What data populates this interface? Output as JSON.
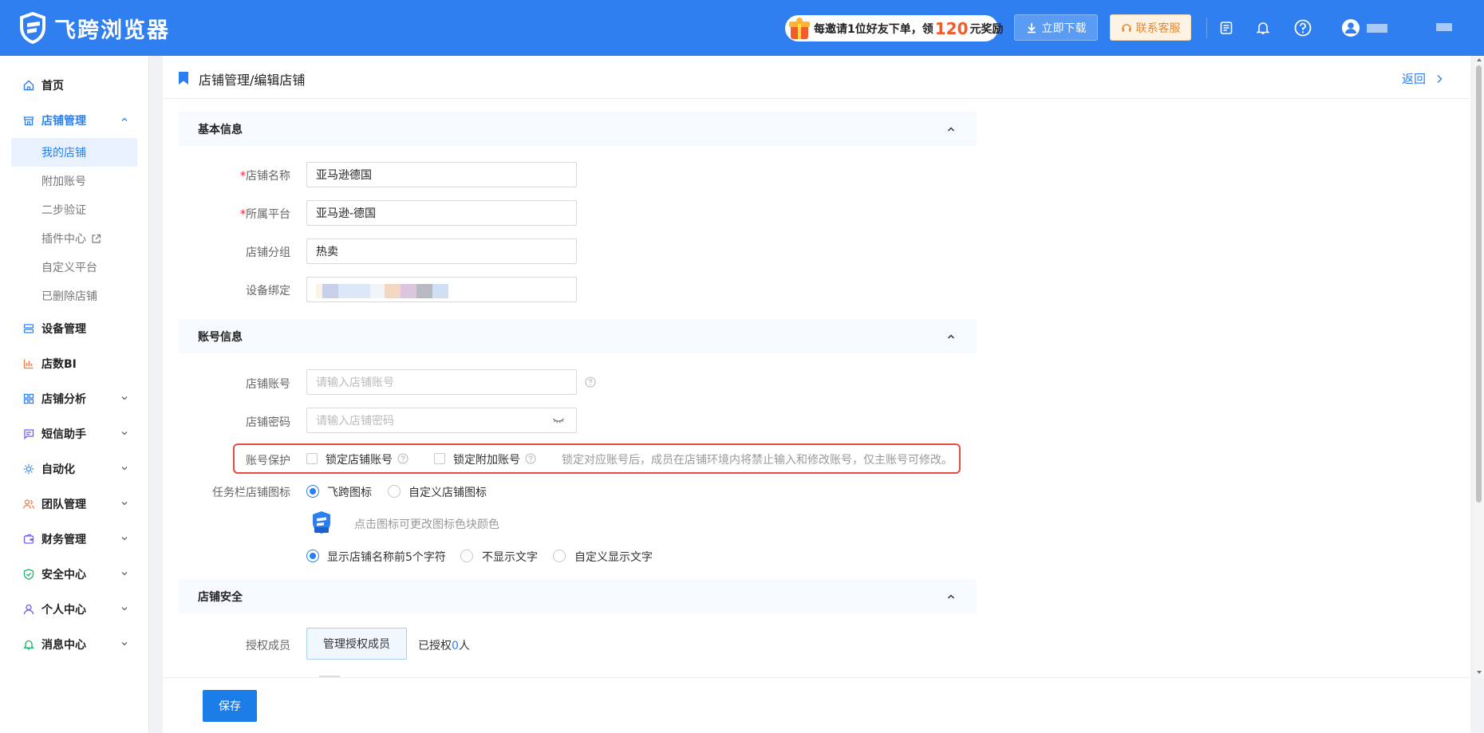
{
  "header": {
    "app_name": "飞跨浏览器",
    "promo_prefix": "每邀请1位好友下单，领",
    "promo_amount": "120",
    "promo_suffix": "元奖励",
    "download_label": "立即下载",
    "service_label": "联系客服",
    "colors": {
      "bar": "#2f7ff0",
      "promo_amount": "#f25b2a",
      "service": "#e8882a"
    }
  },
  "sidebar": {
    "home": "首页",
    "store_mgmt": "店铺管理",
    "store_sub": [
      "我的店铺",
      "附加账号",
      "二步验证",
      "插件中心",
      "自定义平台",
      "已删除店铺"
    ],
    "items": [
      "设备管理",
      "店数BI",
      "店铺分析",
      "短信助手",
      "自动化",
      "团队管理",
      "财务管理",
      "安全中心",
      "个人中心",
      "消息中心"
    ]
  },
  "breadcrumb": {
    "title": "店铺管理/编辑店铺",
    "back": "返回"
  },
  "basic": {
    "title": "基本信息",
    "name_label": "店铺名称",
    "name_value": "亚马逊德国",
    "platform_label": "所属平台",
    "platform_value": "亚马逊-德国",
    "group_label": "店铺分组",
    "group_value": "热卖",
    "device_label": "设备绑定"
  },
  "account": {
    "title": "账号信息",
    "account_label": "店铺账号",
    "account_placeholder": "请输入店铺账号",
    "password_label": "店铺密码",
    "password_placeholder": "请输入店铺密码",
    "protect_label": "账号保护",
    "lock_store": "锁定店铺账号",
    "lock_extra": "锁定附加账号",
    "protect_hint": "锁定对应账号后，成员在店铺环境内将禁止输入和修改账号，仅主账号可修改。",
    "taskbar_label": "任务栏店铺图标",
    "icon_opt1": "飞跨图标",
    "icon_opt2": "自定义店铺图标",
    "icon_hint": "点击图标可更改图标色块颜色",
    "text_opt1": "显示店铺名称前5个字符",
    "text_opt2": "不显示文字",
    "text_opt3": "自定义显示文字"
  },
  "security": {
    "title": "店铺安全",
    "auth_label": "授权成员",
    "manage_btn": "管理授权成员",
    "authorized_prefix": "已授权",
    "authorized_count": "0",
    "authorized_suffix": "人"
  },
  "footer": {
    "save": "保存"
  }
}
